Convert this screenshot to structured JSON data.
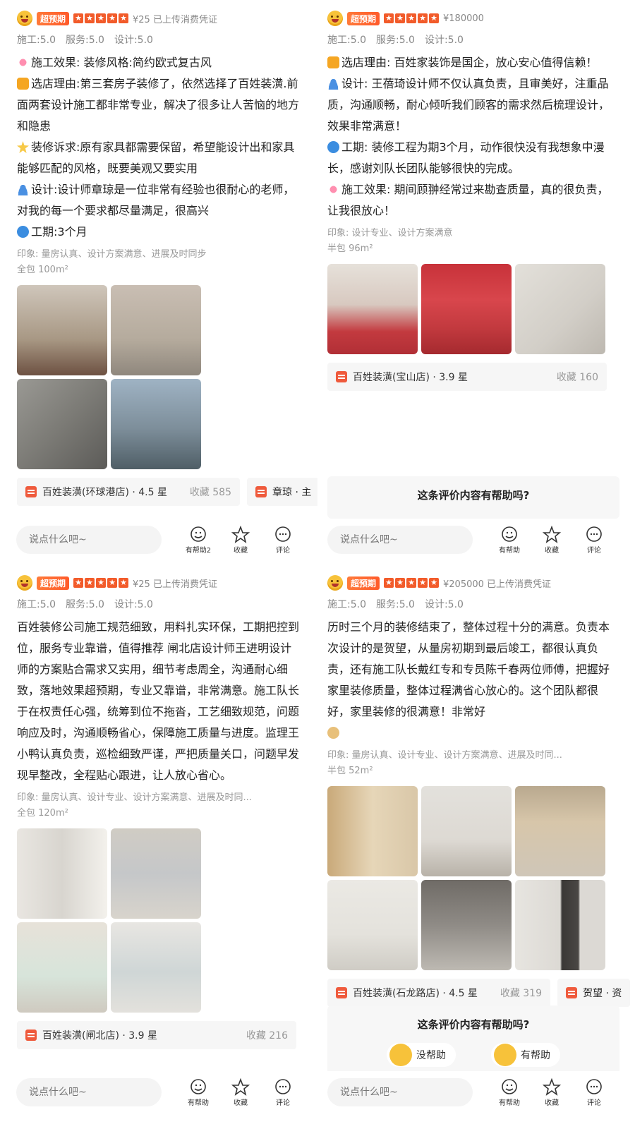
{
  "common": {
    "badge": "超预期",
    "scores": [
      "施工:5.0",
      "服务:5.0",
      "设计:5.0"
    ],
    "comment_placeholder": "说点什么吧~",
    "actions": [
      "有帮助",
      "收藏",
      "评论"
    ],
    "actions_panel0": [
      "有帮助2",
      "收藏",
      "评论"
    ],
    "help_question": "这条评价内容有帮助吗?",
    "help_no": "没帮助",
    "help_yes": "有帮助"
  },
  "reviews": [
    {
      "price": "¥25 已上传消费凭证",
      "paragraphs": [
        "施工效果: 装修风格:简约欧式复古风",
        "选店理由:第三套房子装修了，依然选择了百姓装潢.前面两套设计施工都非常专业，解决了很多让人苦恼的地方和隐患",
        "装修诉求:原有家具都需要保留，希望能设计出和家具能够匹配的风格，既要美观又要实用",
        "设计:设计师章琼是一位非常有经验也很耐心的老师，对我的每一个要求都尽量满足，很高兴",
        "工期:3个月"
      ],
      "impression": "印象:  量房认真、设计方案满意、进展及时同步",
      "package": "全包 100m²",
      "shop": "百姓装潢(环球港店) · 4.5 星",
      "favorites": "收藏 585",
      "person": "章琼 · 主"
    },
    {
      "price": "¥180000",
      "paragraphs": [
        "选店理由:  百姓家装饰是国企，放心安心值得信赖！",
        "设计:  王蓓琦设计师不仅认真负责，且审美好，注重品质，沟通顺畅，耐心倾听我们顾客的需求然后梳理设计，效果非常满意！",
        "工期:  装修工程为期3个月，动作很快没有我想象中漫长，感谢刘队长团队能够很快的完成。",
        "施工效果:  期间顾翀经常过来勘查质量，真的很负责，让我很放心！"
      ],
      "impression": "印象:  设计专业、设计方案满意",
      "package": "半包 96m²",
      "shop": "百姓装潢(宝山店) · 3.9 星",
      "favorites": "收藏 160"
    },
    {
      "price": "¥25 已上传消费凭证",
      "paragraphs": [
        "百姓装修公司施工规范细致，用料扎实环保，工期把控到位，服务专业靠谱，值得推荐 闸北店设计师王进明设计师的方案贴合需求又实用，细节考虑周全，沟通耐心细致，落地效果超预期，专业又靠谱，非常满意。施工队长于在权责任心强，统筹到位不拖沓，工艺细致规范，问题响应及时，沟通顺畅省心，保障施工质量与进度。监理王小鸭认真负责，巡检细致严谨，严把质量关口，问题早发现早整改，全程贴心跟进，让人放心省心。"
      ],
      "impression": "印象:  量房认真、设计专业、设计方案满意、进展及时同...",
      "package": "全包 120m²",
      "shop": "百姓装潢(闸北店) · 3.9 星",
      "favorites": "收藏 216"
    },
    {
      "price": "¥205000 已上传消费凭证",
      "paragraphs": [
        "历时三个月的装修结束了，整体过程十分的满意。负责本次设计的是贺望，从量房初期到最后竣工，都很认真负责，还有施工队长戴红专和专员陈千春两位师傅，把握好家里装修质量，整体过程满省心放心的。这个团队都很好，家里装修的很满意！非常好"
      ],
      "impression": "印象:  量房认真、设计专业、设计方案满意、进展及时同...",
      "package": "半包 52m²",
      "shop": "百姓装潢(石龙路店) · 4.5 星",
      "favorites": "收藏 319",
      "person": "贺望 · 资"
    }
  ],
  "colors": {
    "accent": "#f25b2a",
    "photo_palettes": [
      [
        "#cfc6bb",
        "#bdb4a8",
        "#8e8b86",
        "#5d6b79"
      ],
      [
        "#d8cfc6",
        "#c33a3f",
        "#d9d6cf"
      ],
      [
        "#e9e6e1",
        "#d6d4cf",
        "#e7e2d9",
        "#d9d8d4"
      ],
      [
        "#d9c7a8",
        "#ddd9d3",
        "#cfc6b8",
        "#e4e2dc",
        "#8f8b86",
        "#dcd9d4"
      ]
    ]
  }
}
